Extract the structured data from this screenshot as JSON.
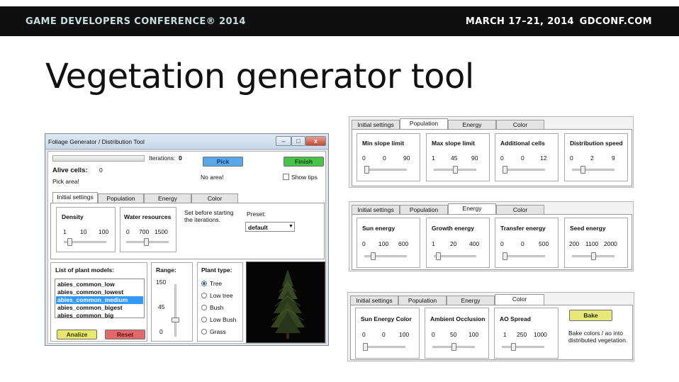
{
  "slide": {
    "conference": "GAME DEVELOPERS CONFERENCE® 2014",
    "dates": "MARCH 17–21, 2014",
    "site": "GDCONF.COM",
    "title": "Vegetation generator tool"
  },
  "window": {
    "title": "Foliage Generator / Distribution Tool",
    "controls": [
      "–",
      "□",
      "x"
    ],
    "iterations_label": "Iterations:",
    "iterations_value": "0",
    "pick_label": "Pick",
    "finish_label": "Finish",
    "alive_label": "Alive cells:",
    "alive_value": "0",
    "no_area": "No area!",
    "pick_area": "Pick area!",
    "show_tips_label": "Show tips",
    "show_tips_checked": false,
    "progress": 0,
    "tabs": [
      "Initial settings",
      "Population",
      "Energy",
      "Color"
    ],
    "active_tab": 0,
    "density": {
      "label": "Density",
      "min": "1",
      "val": "10",
      "max": "100",
      "level": 0.09
    },
    "water": {
      "label": "Water resources",
      "min": "0",
      "val": "700",
      "max": "1500",
      "level": 0.47
    },
    "hint": "Set before starting the iterations.",
    "preset_label": "Preset:",
    "preset_value": "default",
    "plant_list_label": "List of plant models:",
    "plant_models": [
      "abies_common_low",
      "abies_common_lowest",
      "abies_common_medium",
      "abies_common_bigest",
      "abies_common_big"
    ],
    "selected_model": 2,
    "analize_label": "Analize",
    "reset_label": "Reset",
    "range": {
      "label": "Range:",
      "top": "150",
      "mid": "45",
      "bottom": "0",
      "level": 0.3
    },
    "plant_type_label": "Plant type:",
    "plant_types": [
      "Tree",
      "Low tree",
      "Bush",
      "Low Bush",
      "Grass"
    ],
    "selected_type": 0
  },
  "panels": [
    {
      "tabs": [
        "Initial settings",
        "Population",
        "Energy",
        "Color"
      ],
      "active_tab": 1,
      "groups": [
        {
          "label": "Min slope limit",
          "min": "0",
          "val": "0",
          "max": "90",
          "level": 0.0
        },
        {
          "label": "Max slope limit",
          "min": "1",
          "val": "45",
          "max": "90",
          "level": 0.5
        },
        {
          "label": "Additional cells",
          "min": "0",
          "val": "0",
          "max": "12",
          "level": 0.0
        },
        {
          "label": "Distribution speed",
          "min": "0",
          "val": "2",
          "max": "9",
          "level": 0.22
        }
      ]
    },
    {
      "tabs": [
        "Initial settings",
        "Population",
        "Energy",
        "Color"
      ],
      "active_tab": 2,
      "groups": [
        {
          "label": "Sun energy",
          "min": "0",
          "val": "100",
          "max": "600",
          "level": 0.17
        },
        {
          "label": "Growth energy",
          "min": "1",
          "val": "20",
          "max": "400",
          "level": 0.05
        },
        {
          "label": "Transfer energy",
          "min": "0",
          "val": "0",
          "max": "500",
          "level": 0.0
        },
        {
          "label": "Seed energy",
          "min": "200",
          "val": "1100",
          "max": "2000",
          "level": 0.5
        }
      ]
    },
    {
      "tabs": [
        "Initial settings",
        "Population",
        "Energy",
        "Color"
      ],
      "active_tab": 3,
      "groups": [
        {
          "label": "Sun Energy Color",
          "min": "0",
          "val": "0",
          "max": "100",
          "level": 0.0
        },
        {
          "label": "Ambient Occlusion",
          "min": "0",
          "val": "50",
          "max": "100",
          "level": 0.5
        },
        {
          "label": "AO Spread",
          "min": "1",
          "val": "250",
          "max": "1000",
          "level": 0.25
        }
      ],
      "bake_label": "Bake",
      "bake_note": "Bake colors / ao into distributed vegetation."
    }
  ],
  "colors": {
    "pick_button": "#5aa7ea",
    "finish_button": "#49c24a",
    "analize_button": "#e8e86a",
    "reset_button": "#e16868",
    "bake_button": "#e6e878",
    "selection": "#3399ff"
  }
}
